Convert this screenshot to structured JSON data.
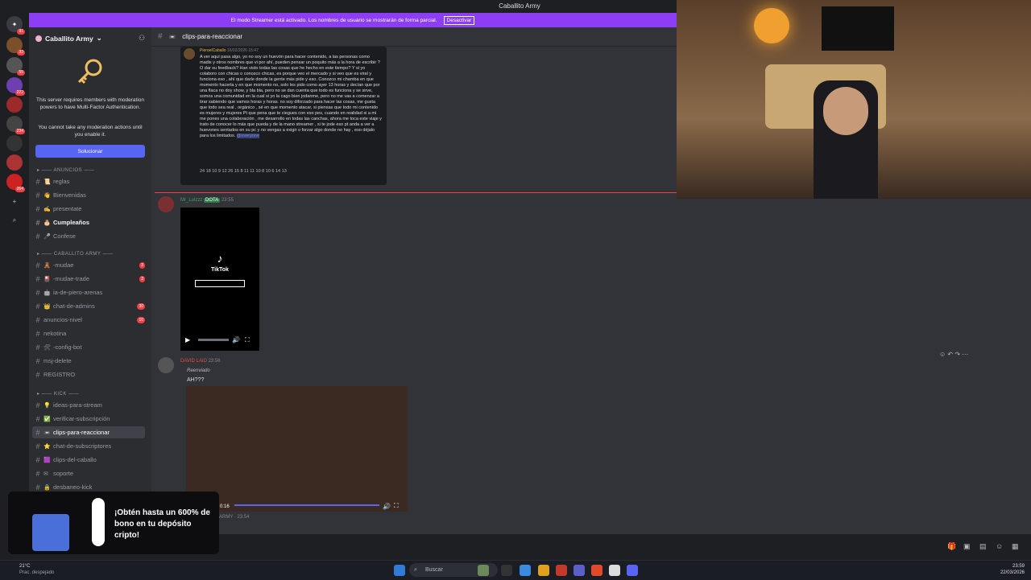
{
  "window": {
    "title": "Caballito Army"
  },
  "streamer_banner": {
    "text": "El modo Streamer está activado. Los nombres de usuario se mostrarán de forma parcial.",
    "button": "Desactivar"
  },
  "server": {
    "name": "Caballito Army",
    "mfa_text_1": "This server requires members with moderation powers to have Multi-Factor Authentication.",
    "mfa_text_2": "You cannot take any moderation actions until you enable it.",
    "mfa_button": "Solucionar"
  },
  "server_badges": [
    "91",
    "33",
    "55",
    "222",
    "234",
    "264"
  ],
  "categories": {
    "anuncios": "ANUNCIOS",
    "caballito": "CABALLITO ARMY",
    "kick": "KICK"
  },
  "channels_anuncios": [
    {
      "label": "reglas",
      "emoji": "📜"
    },
    {
      "label": "Bienvenidas",
      "emoji": "👋"
    },
    {
      "label": "presentate",
      "emoji": "✍"
    },
    {
      "label": "Cumpleaños",
      "emoji": "🎂",
      "bold": true
    },
    {
      "label": "Confese",
      "emoji": "🎤"
    }
  ],
  "channels_caballito": [
    {
      "label": "-mudae",
      "emoji": "🧸",
      "badge": "3"
    },
    {
      "label": "-mudae-trade",
      "emoji": "🎴",
      "badge": "3"
    },
    {
      "label": "ia-de-piero-arenas",
      "emoji": "🤖"
    },
    {
      "label": "chat-de-admins",
      "emoji": "👑",
      "badge": "30"
    },
    {
      "label": "anuncios-nivel",
      "emoji": "",
      "badge": "10"
    },
    {
      "label": "nekotina",
      "emoji": ""
    },
    {
      "label": "-config-bot",
      "emoji": "🛠"
    },
    {
      "label": "msj-delete",
      "emoji": ""
    },
    {
      "label": "REGISTRO",
      "emoji": ""
    }
  ],
  "channels_kick": [
    {
      "label": "ideas-para-stream",
      "emoji": "💡"
    },
    {
      "label": "verificar-subscripción",
      "emoji": "✅"
    },
    {
      "label": "clips-para-reaccionar",
      "emoji": "📼",
      "selected": true
    },
    {
      "label": "chat-de-subscriptores",
      "emoji": "⭐"
    },
    {
      "label": "clips-del-caballo",
      "emoji": "🟪"
    },
    {
      "label": "soporte",
      "emoji": "✉"
    },
    {
      "label": "desbaneo-kick",
      "emoji": "🔒"
    }
  ],
  "channel": {
    "name": "clips-para-reaccionar"
  },
  "embed": {
    "author": "PieroelCaballo",
    "time": "16/02/2026 15:47",
    "text": "A ver aquí pasa algo, yo no soy un huevón para hacer contenido, a las personas como madis y otros nombres que vi por ahí, pueden pensar un poquito más a la hora de escribir ? O dar su feedback? Han visto todas las cosas que he hecho en este tiempo? Y si yo colaboro con chicas o conozco chicas, es porque veo el mercado y si veo que es viral y funciona eso , ahí que darle donde la gente más pide y eso. Conozco mi chamba en que momento hacerla y en que momento no, solo les pido como ayer 13 horas y decían que por una flaca no doy show, y bla bla, pero no se dan cuenta que todo es funciona y se sirve, somos una comunidad en la cual si yo la cago bien jodanme, pero no me vas a comenzar a tirar sabiendo que vamos horas y horas. no soy diforzado para hacer las cosas, me gusta que todo sea real , orgánico , sé en que momento atacar, si piensas que todo mi contenido es mujeres y mujeres Pt que pena que te ciegues con eso pes, cuando en realidad si a mi me pones una colaboración , me desarrollo en todas las canchas, ahora me toca este viaje y trato de conocer lo más que pueda y de la mano streamer , si te jode eso pt anda a ver a huevones sentados en su pc y no vengas a exigir o forzar algo donde no hay , eso déjalo para los limitados.",
    "mention": "@everyone",
    "reactions": "24  18  10  9  12  26  15  8  11  11  10  8  10  6  14  13"
  },
  "msg1": {
    "user": "Mr_Luizzz",
    "tag": "DOTA",
    "time": "23:55",
    "tiktok": "TikTok"
  },
  "msg2": {
    "user": "DAVID LAID",
    "time": "23:56",
    "forwarded": "Reenviado",
    "text": "AH???",
    "video_time": "0:16",
    "footer": "ARMY · 23:54"
  },
  "ad": {
    "headline": "¡Obtén hasta un 600% de bono en tu depósito cripto!"
  },
  "taskbar": {
    "search": "Buscar",
    "weather": "21°C",
    "weather_sub": "Prac. despejado",
    "time": "23:59",
    "date": "22/03/2026"
  }
}
